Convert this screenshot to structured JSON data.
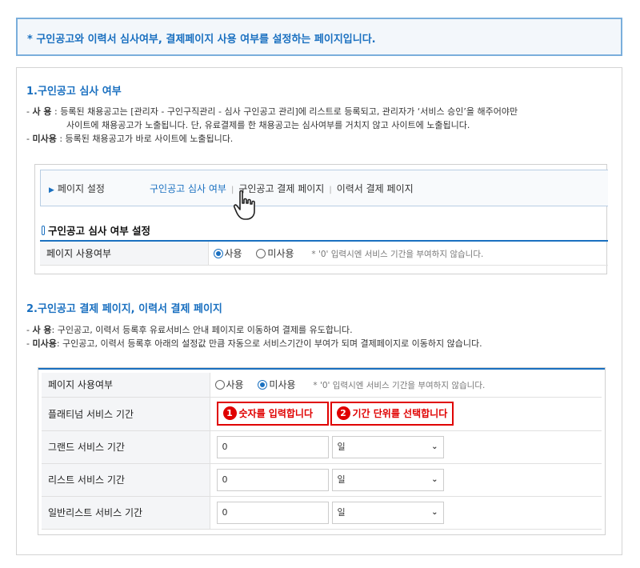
{
  "notice": "* 구인공고와 이력서 심사여부, 결제페이지 사용 여부를 설정하는 페이지입니다.",
  "section1": {
    "title": "1.구인공고 심사 여부",
    "use_label": "사   용",
    "use_desc_1": ": 등록된 채용공고는 [관리자 - 구인구직관리 - 심사 구인공고 관리]에 리스트로 등록되고, 관리자가 ‘서비스 승인’을 해주어야만",
    "use_desc_2": "사이트에 채용공고가 노출됩니다.  단, 유료결제를 한 채용공고는 심사여부를 거치지 않고 사이트에 노출됩니다.",
    "nouse_label": "미사용",
    "nouse_desc": ": 등록된 채용공고가 바로 사이트에 노출됩니다."
  },
  "tabbar": {
    "head": "페이지 설정",
    "tabs": [
      "구인공고 심사 여부",
      "구인공고 결제 페이지",
      "이력서 결제 페이지"
    ]
  },
  "setting1": {
    "title": "구인공고 심사 여부 설정",
    "row_label": "페이지 사용여부",
    "opt_use": "사용",
    "opt_nouse": "미사용",
    "note": "* '0' 입력시엔 서비스 기간을 부여하지 않습니다."
  },
  "section2": {
    "title": "2.구인공고 결제 페이지, 이력서 결제 페이지",
    "use_label": "사   용",
    "use_desc": ": 구인공고, 이력서 등록후 유료서비스 안내 페이지로 이동하여 결제를 유도합니다.",
    "nouse_label": "미사용",
    "nouse_desc": ": 구인공고, 이력서 등록후 아래의 설정값 만큼 자동으로 서비스기간이 부여가 되며 결제페이지로 이동하지 않습니다."
  },
  "setting2": {
    "row_label": "페이지 사용여부",
    "opt_use": "사용",
    "opt_nouse": "미사용",
    "note": "* '0' 입력시엔 서비스 기간을 부여하지 않습니다.",
    "platinum_label": "플래티넘 서비스 기간",
    "callout1_num": "1",
    "callout1": "숫자를 입력합니다",
    "callout2_num": "2",
    "callout2": "기간 단위를 선택합니다",
    "grand_label": "그랜드 서비스 기간",
    "grand_value": "0",
    "grand_unit": "일",
    "list_label": "리스트 서비스 기간",
    "list_value": "0",
    "list_unit": "일",
    "general_label": "일반리스트 서비스 기간",
    "general_value": "0",
    "general_unit": "일"
  }
}
